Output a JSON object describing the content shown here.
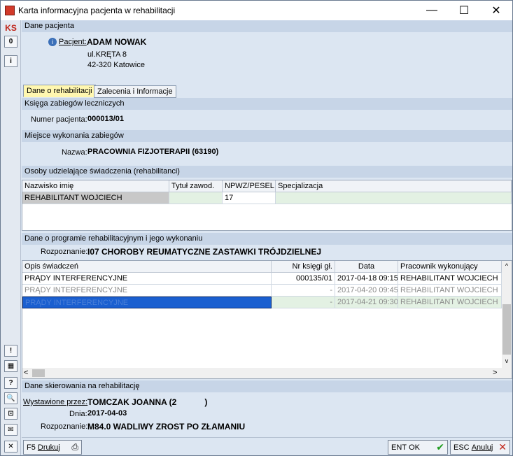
{
  "window": {
    "title": "Karta informacyjna pacjenta w rehabilitacji",
    "minimize": "—",
    "maximize": "☐",
    "close": "✕"
  },
  "toolbar": {
    "top": [
      "KS",
      "0",
      "i"
    ],
    "bottom": [
      "!",
      "▦",
      "?",
      "🔍",
      "⊡",
      "✉",
      "✕"
    ]
  },
  "patient": {
    "header": "Dane pacjenta",
    "label": "Pacjent:",
    "name": "ADAM NOWAK",
    "street": "ul.KRĘTA 8",
    "city": "42-320 Katowice"
  },
  "tabs": [
    {
      "label": "Dane o rehabilitacji",
      "active": true
    },
    {
      "label": "Zalecenia i Informacje",
      "active": false
    }
  ],
  "book": {
    "header": "Księga zabiegów leczniczych",
    "label": "Numer pacjenta:",
    "value": "000013/01"
  },
  "place": {
    "header": "Miejsce wykonania zabiegów",
    "label": "Nazwa:",
    "value": "PRACOWNIA FIZJOTERAPII (63190)"
  },
  "providers": {
    "header": "Osoby udzielające świadczenia (rehabilitanci)",
    "columns": [
      "Nazwisko imię",
      "Tytuł zawod.",
      "NPWZ/PESEL",
      "Specjalizacja"
    ],
    "rows": [
      [
        "REHABILITANT WOJCIECH",
        "",
        "17",
        ""
      ]
    ]
  },
  "program": {
    "header": "Dane o programie rehabilitacyjnym i jego wykonaniu",
    "label": "Rozpoznanie:",
    "value": "I07 CHOROBY REUMATYCZNE ZASTAWKI TRÓJDZIELNEJ",
    "columns": [
      "Opis świadczeń",
      "Nr księgi gł.",
      "Data",
      "Pracownik wykonujący"
    ],
    "rows": [
      [
        "PRĄDY INTERFERENCYJNE",
        "000135/01",
        "2017-04-18 09:15",
        "REHABILITANT WOJCIECH"
      ],
      [
        "PRĄDY INTERFERENCYJNE",
        "-",
        "2017-04-20 09:45",
        "REHABILITANT WOJCIECH"
      ],
      [
        "PRĄDY INTERFERENCYJNE",
        "-",
        "2017-04-21 09:30",
        "REHABILITANT WOJCIECH"
      ]
    ],
    "scroll_left": "<",
    "scroll_right": ">",
    "scroll_up": "^",
    "scroll_down": "v"
  },
  "referral": {
    "header": "Dane skierowania na rehabilitację",
    "issued_label": "Wystawione przez:",
    "issued_value": "TOMCZAK JOANNA (2",
    "issued_suffix": ")",
    "date_label": "Dnia:",
    "date_value": "2017-04-03",
    "diag_label": "Rozpoznanie:",
    "diag_value": "M84.0 WADLIWY ZROST PO ZŁAMANIU"
  },
  "buttons": {
    "print_key": "F5",
    "print_label": "Drukuj",
    "ok_key": "ENT",
    "ok_label": "OK",
    "cancel_key": "ESC",
    "cancel_label": "Anuluj"
  }
}
